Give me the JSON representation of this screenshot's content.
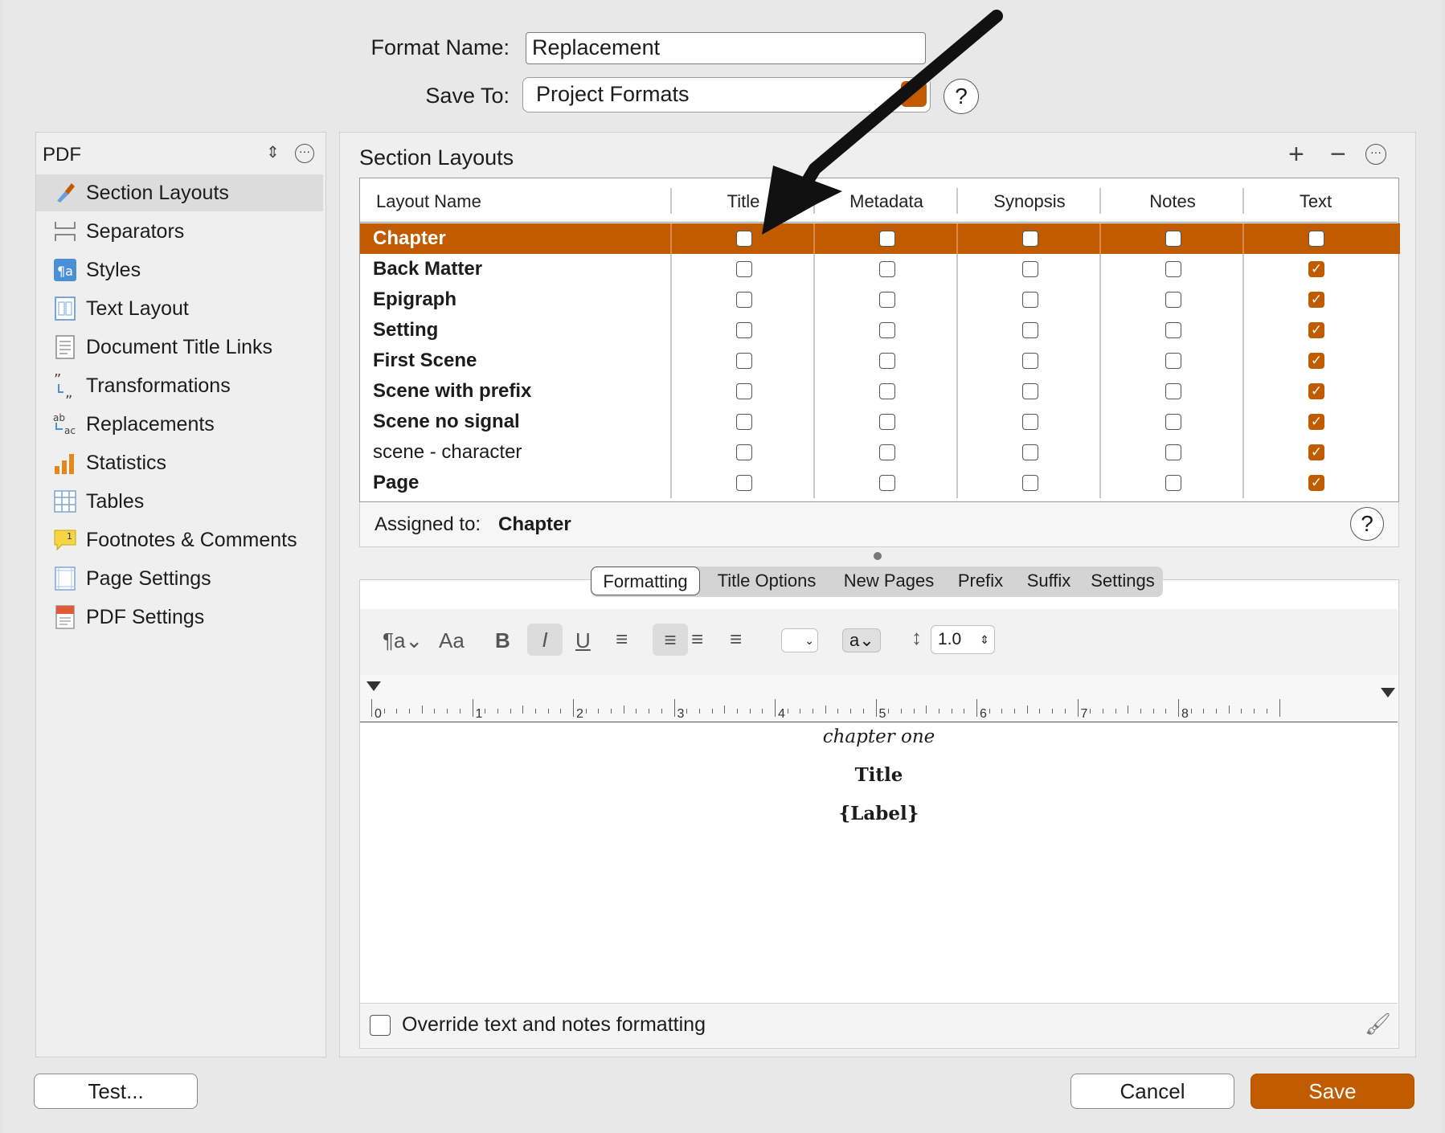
{
  "header": {
    "format_name_label": "Format Name:",
    "format_name_value": "Replacement",
    "save_to_label": "Save To:",
    "save_to_value": "Project Formats",
    "help_glyph": "?"
  },
  "sidebar": {
    "selector": "PDF",
    "items": [
      {
        "label": "Section Layouts",
        "icon": "brush-icon"
      },
      {
        "label": "Separators",
        "icon": "separators-icon"
      },
      {
        "label": "Styles",
        "icon": "styles-icon"
      },
      {
        "label": "Text Layout",
        "icon": "text-layout-icon"
      },
      {
        "label": "Document Title Links",
        "icon": "document-icon"
      },
      {
        "label": "Transformations",
        "icon": "quotes-icon"
      },
      {
        "label": "Replacements",
        "icon": "replacements-icon"
      },
      {
        "label": "Statistics",
        "icon": "bar-chart-icon"
      },
      {
        "label": "Tables",
        "icon": "table-icon"
      },
      {
        "label": "Footnotes & Comments",
        "icon": "footnote-icon"
      },
      {
        "label": "Page Settings",
        "icon": "page-settings-icon"
      },
      {
        "label": "PDF Settings",
        "icon": "pdf-icon"
      }
    ]
  },
  "section_layouts": {
    "title": "Section Layouts",
    "columns": [
      "Layout Name",
      "Title",
      "Metadata",
      "Synopsis",
      "Notes",
      "Text"
    ],
    "rows": [
      {
        "name": "Chapter",
        "bold": true,
        "checks": [
          false,
          false,
          false,
          false,
          false
        ]
      },
      {
        "name": "Back Matter",
        "bold": true,
        "checks": [
          false,
          false,
          false,
          false,
          true
        ]
      },
      {
        "name": "Epigraph",
        "bold": true,
        "checks": [
          false,
          false,
          false,
          false,
          true
        ]
      },
      {
        "name": "Setting",
        "bold": true,
        "checks": [
          false,
          false,
          false,
          false,
          true
        ]
      },
      {
        "name": "First Scene",
        "bold": true,
        "checks": [
          false,
          false,
          false,
          false,
          true
        ]
      },
      {
        "name": "Scene with prefix",
        "bold": true,
        "checks": [
          false,
          false,
          false,
          false,
          true
        ]
      },
      {
        "name": "Scene no signal",
        "bold": true,
        "checks": [
          false,
          false,
          false,
          false,
          true
        ]
      },
      {
        "name": "scene - character",
        "bold": false,
        "checks": [
          false,
          false,
          false,
          false,
          true
        ]
      },
      {
        "name": "Page",
        "bold": true,
        "checks": [
          false,
          false,
          false,
          false,
          true
        ]
      }
    ],
    "assigned_label": "Assigned to:",
    "assigned_value": "Chapter"
  },
  "tabs": [
    "Formatting",
    "Title Options",
    "New Pages",
    "Prefix",
    "Suffix",
    "Settings"
  ],
  "toolbar": {
    "line_spacing": "1.0",
    "font_case": "a"
  },
  "ruler": [
    "0",
    "1",
    "2",
    "3",
    "4",
    "5",
    "6",
    "7",
    "8"
  ],
  "preview": {
    "line1": "chapter one",
    "line2": "Title",
    "line3": "{Label}"
  },
  "override_label": "Override text and notes formatting",
  "buttons": {
    "test": "Test...",
    "cancel": "Cancel",
    "save": "Save"
  },
  "colors": {
    "accent": "#c15b00"
  }
}
